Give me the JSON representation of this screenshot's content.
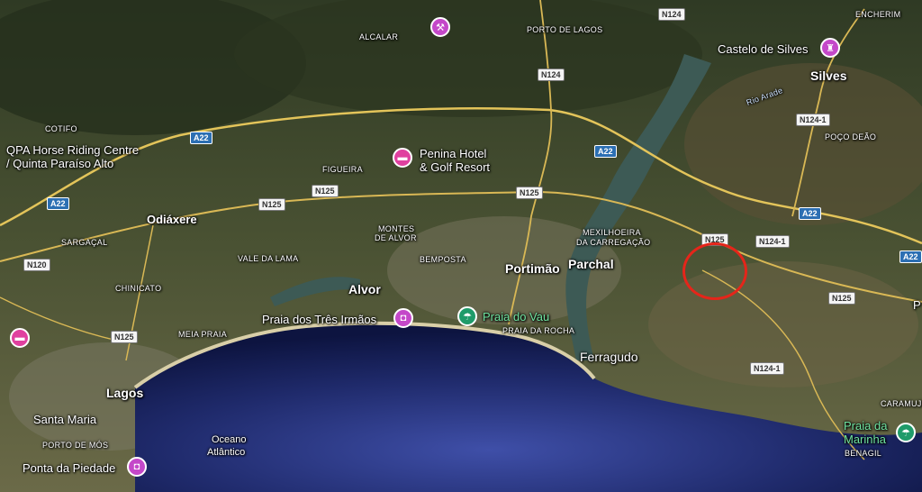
{
  "map": {
    "highlight_color": "#e5251a",
    "places": {
      "encherim": "ENCHERIM",
      "castelo_de_silves": "Castelo de Silves",
      "silves": "Silves",
      "rio_arade": "Rio Arade",
      "poco_deao": "POÇO DEÃO",
      "porto_de_lagos": "PORTO DE LAGOS",
      "alcalar": "ALCALAR",
      "cotifo": "COTIFO",
      "qpa_line1": "QPA Horse Riding Centre",
      "qpa_line2": "/ Quinta Paraíso Alto",
      "penina_line1": "Penina Hotel",
      "penina_line2": "& Golf Resort",
      "figueira": "FIGUEIRA",
      "odiaxere": "Odiáxere",
      "montes_line1": "MONTES",
      "montes_line2": "DE ALVOR",
      "mexilhoeira_line1": "MEXILHOEIRA",
      "mexilhoeira_line2": "DA CARREGAÇÃO",
      "sargacal": "SARGAÇAL",
      "vale_da_lama": "VALE DA LAMA",
      "bemposta": "BEMPOSTA",
      "portimao": "Portimão",
      "parchal": "Parchal",
      "chinicato": "CHINICATO",
      "alvor": "Alvor",
      "praia_tres_irmaos": "Praia dos Três Irmãos",
      "praia_do_vau": "Praia do Vau",
      "praia_da_rocha": "PRAIA DA ROCHA",
      "meia_praia": "MEIA PRAIA",
      "ferragudo": "Ferragudo",
      "lagos": "Lagos",
      "santa_maria": "Santa Maria",
      "porto_de_mos": "PORTO DE MÓS",
      "oceano_line1": "Oceano",
      "oceano_line2": "Atlântico",
      "ponta_da_piedade": "Ponta da Piedade",
      "caramujeira": "CARAMUJE",
      "praia_marinha_line1": "Praia da",
      "praia_marinha_line2": "Marinha",
      "benagil": "BENAGIL",
      "edge_p": "P"
    },
    "roads": {
      "n124_top": "N124",
      "n124_mid": "N124",
      "n124_1_silves": "N124-1",
      "a22_west": "A22",
      "a22_center": "A22",
      "a22_east": "A22",
      "a22_far_west": "A22",
      "a22_far_east": "A22",
      "n125_west": "N125",
      "n125_mid": "N125",
      "n125_portimao": "N125",
      "n125_parchal": "N125",
      "n124_1_east": "N124-1",
      "n125_east": "N125",
      "n120": "N120",
      "n125_lagos": "N125",
      "n124_1_south": "N124-1"
    }
  }
}
